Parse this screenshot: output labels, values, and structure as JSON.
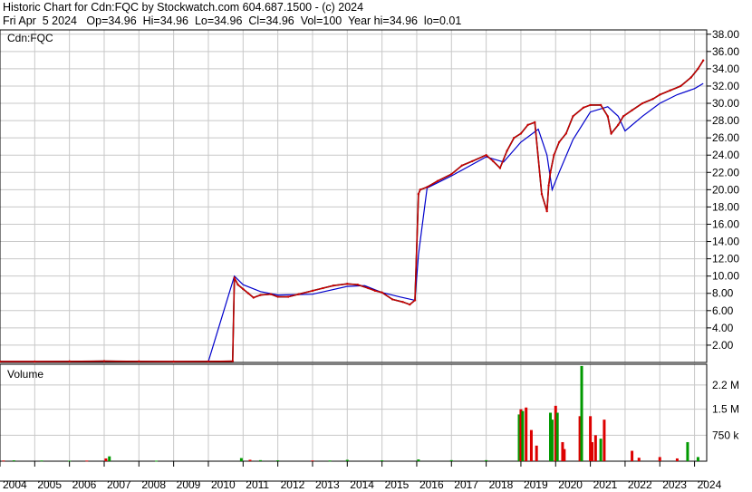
{
  "header": {
    "line1": "Historic Chart for Cdn:FQC by Stockwatch.com 604.687.1500 - (c) 2024",
    "line2": "Fri Apr  5 2024   Op=34.96  Hi=34.96  Lo=34.96  Cl=34.96  Vol=100  Year hi=34.96  lo=0.01"
  },
  "chart_data": {
    "type": "line",
    "symbol_label": "Cdn:FQC",
    "volume_label": "Volume",
    "price_axis": {
      "ylim": [
        0,
        38.5
      ],
      "ticks": [
        "2.00",
        "4.00",
        "6.00",
        "8.00",
        "10.00",
        "12.00",
        "14.00",
        "16.00",
        "18.00",
        "20.00",
        "22.00",
        "24.00",
        "26.00",
        "28.00",
        "30.00",
        "32.00",
        "34.00",
        "36.00",
        "38.00"
      ]
    },
    "volume_axis": {
      "ylim": [
        0,
        2800000
      ],
      "ticks": [
        {
          "label": "750 k",
          "value": 750000
        },
        {
          "label": "1.5 M",
          "value": 1500000
        },
        {
          "label": "2.2 M",
          "value": 2200000
        }
      ]
    },
    "xlim": [
      2004,
      2024.35
    ],
    "x_ticks": [
      "2004",
      "2005",
      "2006",
      "2007",
      "2008",
      "2009",
      "2010",
      "2011",
      "2012",
      "2013",
      "2014",
      "2015",
      "2016",
      "2017",
      "2018",
      "2019",
      "2020",
      "2021",
      "2022",
      "2023",
      "2024"
    ],
    "colors": {
      "price": "#cc0000",
      "price_alt": "#000000",
      "moving_average": "#0000cc",
      "volume_up": "#009900",
      "volume_down": "#dd0000",
      "grid": "#c8c8c8"
    },
    "series": [
      {
        "role": "price",
        "x": [
          2004.0,
          2005.0,
          2006.0,
          2007.0,
          2008.0,
          2009.0,
          2010.0,
          2010.7,
          2010.75,
          2010.85,
          2011.0,
          2011.15,
          2011.3,
          2011.5,
          2011.8,
          2012.0,
          2012.3,
          2012.6,
          2013.0,
          2013.3,
          2013.6,
          2014.0,
          2014.3,
          2014.6,
          2014.8,
          2015.0,
          2015.3,
          2015.6,
          2015.8,
          2015.95,
          2016.05,
          2016.1,
          2016.3,
          2016.6,
          2017.0,
          2017.3,
          2017.6,
          2018.0,
          2018.2,
          2018.4,
          2018.6,
          2018.8,
          2019.0,
          2019.2,
          2019.4,
          2019.6,
          2019.75,
          2019.8,
          2019.85,
          2019.95,
          2020.1,
          2020.3,
          2020.5,
          2020.8,
          2021.0,
          2021.3,
          2021.5,
          2021.6,
          2021.8,
          2021.95,
          2022.2,
          2022.5,
          2022.8,
          2023.0,
          2023.3,
          2023.6,
          2023.9,
          2024.1,
          2024.25
        ],
        "y": [
          0.1,
          0.1,
          0.12,
          0.15,
          0.12,
          0.1,
          0.12,
          0.15,
          9.8,
          9.0,
          8.5,
          8.0,
          7.5,
          7.8,
          7.9,
          7.6,
          7.6,
          7.9,
          8.3,
          8.6,
          8.9,
          9.1,
          9.0,
          8.6,
          8.3,
          8.1,
          7.3,
          7.0,
          6.7,
          7.2,
          19.5,
          20.0,
          20.3,
          21.0,
          21.8,
          22.8,
          23.3,
          24.0,
          23.3,
          22.5,
          24.5,
          26.0,
          26.5,
          27.5,
          27.8,
          19.5,
          17.5,
          20.5,
          22.0,
          24.0,
          25.5,
          26.5,
          28.5,
          29.5,
          29.8,
          29.8,
          28.5,
          26.5,
          27.5,
          28.5,
          29.2,
          30.0,
          30.5,
          31.0,
          31.5,
          32.0,
          33.0,
          34.0,
          34.96
        ]
      },
      {
        "role": "moving_average",
        "x": [
          2004.0,
          2010.0,
          2010.75,
          2011.0,
          2011.5,
          2012.0,
          2013.0,
          2014.0,
          2014.5,
          2015.0,
          2015.5,
          2015.95,
          2016.05,
          2016.3,
          2017.0,
          2018.0,
          2018.5,
          2019.0,
          2019.5,
          2019.75,
          2019.9,
          2020.1,
          2020.5,
          2021.0,
          2021.5,
          2021.8,
          2022.0,
          2022.5,
          2023.0,
          2023.5,
          2024.0,
          2024.25
        ],
        "y": [
          0.1,
          0.12,
          10.0,
          9.0,
          8.2,
          7.8,
          7.9,
          8.8,
          8.9,
          8.1,
          7.6,
          7.2,
          12.5,
          20.2,
          21.6,
          23.8,
          23.2,
          25.5,
          27.0,
          24.0,
          20.0,
          22.0,
          25.8,
          29.0,
          29.6,
          28.5,
          26.8,
          28.5,
          30.0,
          31.0,
          31.7,
          32.3
        ]
      },
      {
        "role": "volume",
        "x": [
          2004.1,
          2004.4,
          2005.2,
          2006.0,
          2006.5,
          2007.05,
          2007.15,
          2008.5,
          2010.95,
          2011.2,
          2011.5,
          2012.0,
          2013.0,
          2013.5,
          2014.0,
          2015.0,
          2016.05,
          2017.0,
          2018.0,
          2018.95,
          2019.0,
          2019.05,
          2019.15,
          2019.3,
          2019.45,
          2019.85,
          2019.9,
          2020.0,
          2020.05,
          2020.2,
          2020.25,
          2020.7,
          2020.75,
          2021.0,
          2021.05,
          2021.15,
          2021.3,
          2021.4,
          2022.2,
          2022.4,
          2023.0,
          2023.5,
          2023.8,
          2024.1
        ],
        "y": [
          20000,
          25000,
          20000,
          15000,
          18000,
          80000,
          140000,
          15000,
          90000,
          40000,
          30000,
          25000,
          20000,
          20000,
          40000,
          25000,
          50000,
          30000,
          30000,
          1350000,
          1500000,
          1450000,
          1550000,
          900000,
          450000,
          1400000,
          1200000,
          1600000,
          1400000,
          550000,
          350000,
          1300000,
          2750000,
          1300000,
          550000,
          750000,
          650000,
          1200000,
          300000,
          100000,
          120000,
          80000,
          550000,
          120000
        ],
        "direction": [
          "down",
          "up",
          "up",
          "up",
          "down",
          "down",
          "up",
          "up",
          "up",
          "down",
          "up",
          "up",
          "down",
          "up",
          "up",
          "up",
          "up",
          "up",
          "up",
          "up",
          "down",
          "up",
          "down",
          "down",
          "down",
          "up",
          "up",
          "down",
          "up",
          "down",
          "down",
          "down",
          "up",
          "down",
          "down",
          "down",
          "up",
          "down",
          "down",
          "down",
          "down",
          "down",
          "up",
          "up"
        ]
      }
    ]
  }
}
